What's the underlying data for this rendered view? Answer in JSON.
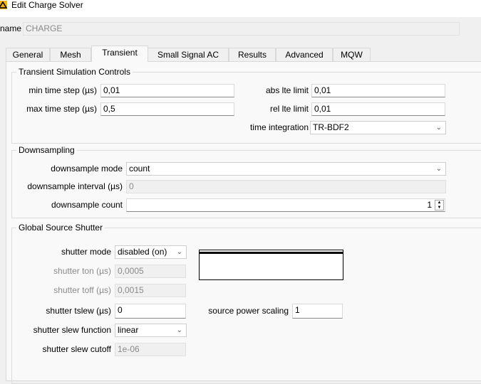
{
  "window": {
    "title": "Edit Charge Solver",
    "icon": "warning-triangle-icon"
  },
  "name_field": {
    "label": "name",
    "value": "CHARGE"
  },
  "tabs": [
    {
      "label": "General"
    },
    {
      "label": "Mesh"
    },
    {
      "label": "Transient",
      "active": true
    },
    {
      "label": "Small Signal AC"
    },
    {
      "label": "Results"
    },
    {
      "label": "Advanced"
    },
    {
      "label": "MQW"
    }
  ],
  "transient": {
    "title": "Transient Simulation Controls",
    "min_time_step": {
      "label": "min time step (µs)",
      "value": "0,01"
    },
    "max_time_step": {
      "label": "max time step (µs)",
      "value": "0,5"
    },
    "abs_lte": {
      "label": "abs lte limit",
      "value": "0,01"
    },
    "rel_lte": {
      "label": "rel lte limit",
      "value": "0,01"
    },
    "time_integration": {
      "label": "time integration",
      "value": "TR-BDF2"
    }
  },
  "downsampling": {
    "title": "Downsampling",
    "mode": {
      "label": "downsample mode",
      "value": "count"
    },
    "interval": {
      "label": "downsample interval (µs)",
      "value": "0"
    },
    "count": {
      "label": "downsample count",
      "value": "1"
    }
  },
  "shutter": {
    "title": "Global Source Shutter",
    "mode": {
      "label": "shutter mode",
      "value": "disabled (on)"
    },
    "ton": {
      "label": "shutter ton (µs)",
      "value": "0,0005"
    },
    "toff": {
      "label": "shutter toff (µs)",
      "value": "0,0015"
    },
    "tslew": {
      "label": "shutter tslew (µs)",
      "value": "0"
    },
    "slew_function": {
      "label": "shutter slew function",
      "value": "linear"
    },
    "slew_cutoff": {
      "label": "shutter slew cutoff",
      "value": "1e-06"
    },
    "power_scaling": {
      "label": "source power scaling",
      "value": "1"
    }
  }
}
